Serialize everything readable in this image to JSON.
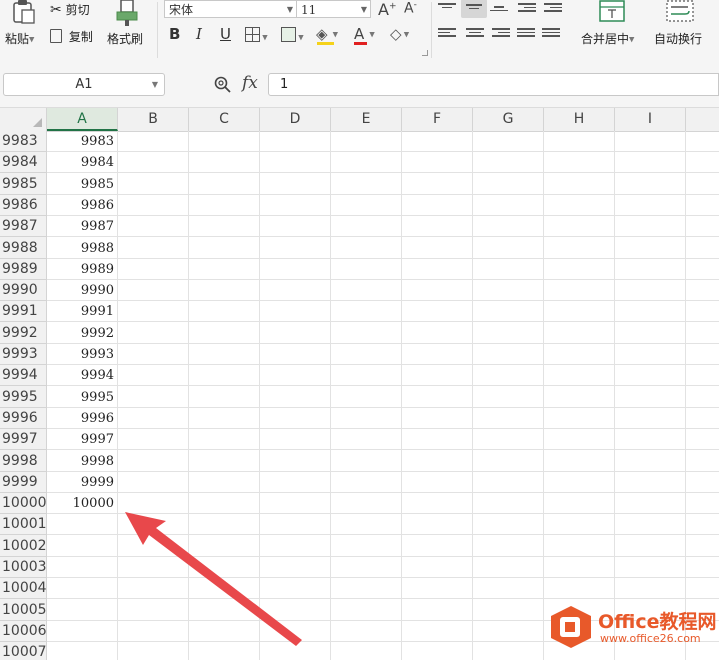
{
  "ribbon": {
    "paste": "粘贴",
    "cut": "剪切",
    "copy": "复制",
    "format_painter": "格式刷",
    "font_name": "宋体",
    "font_size": "11",
    "merge_center": "合并居中",
    "wrap_text": "自动换行",
    "bold": "B",
    "italic": "I",
    "underline": "U",
    "increase_font": "A⁺",
    "decrease_font": "A⁻",
    "font_color_letter": "A"
  },
  "formula_bar": {
    "name_box": "A1",
    "fx_label": "fx",
    "formula": "1"
  },
  "columns": [
    "A",
    "B",
    "C",
    "D",
    "E",
    "F",
    "G",
    "H",
    "I"
  ],
  "rows": [
    {
      "num": "9983",
      "a": "9983"
    },
    {
      "num": "9984",
      "a": "9984"
    },
    {
      "num": "9985",
      "a": "9985"
    },
    {
      "num": "9986",
      "a": "9986"
    },
    {
      "num": "9987",
      "a": "9987"
    },
    {
      "num": "9988",
      "a": "9988"
    },
    {
      "num": "9989",
      "a": "9989"
    },
    {
      "num": "9990",
      "a": "9990"
    },
    {
      "num": "9991",
      "a": "9991"
    },
    {
      "num": "9992",
      "a": "9992"
    },
    {
      "num": "9993",
      "a": "9993"
    },
    {
      "num": "9994",
      "a": "9994"
    },
    {
      "num": "9995",
      "a": "9995"
    },
    {
      "num": "9996",
      "a": "9996"
    },
    {
      "num": "9997",
      "a": "9997"
    },
    {
      "num": "9998",
      "a": "9998"
    },
    {
      "num": "9999",
      "a": "9999"
    },
    {
      "num": "10000",
      "a": "10000"
    },
    {
      "num": "10001",
      "a": ""
    },
    {
      "num": "10002",
      "a": ""
    },
    {
      "num": "10003",
      "a": ""
    },
    {
      "num": "10004",
      "a": ""
    },
    {
      "num": "10005",
      "a": ""
    },
    {
      "num": "10006",
      "a": ""
    },
    {
      "num": "10007",
      "a": ""
    }
  ],
  "watermark": {
    "brand": "Office教程网",
    "url": "www.office26.com"
  },
  "colors": {
    "selection_green": "#217346",
    "arrow_red": "#e8484b",
    "logo_orange": "#e8592a"
  }
}
